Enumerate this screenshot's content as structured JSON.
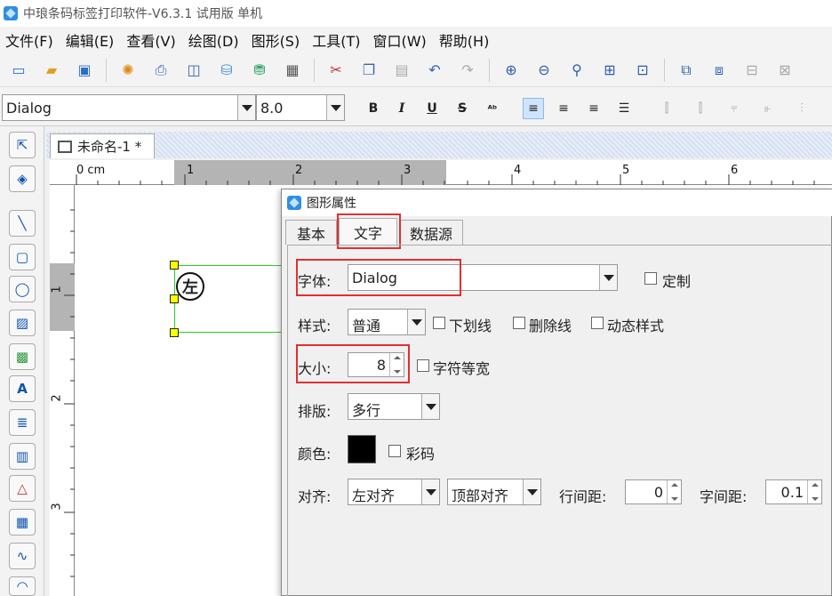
{
  "app": {
    "title": "中琅条码标签打印软件-V6.3.1 试用版 单机"
  },
  "menu": [
    "文件(F)",
    "编辑(E)",
    "查看(V)",
    "绘图(D)",
    "图形(S)",
    "工具(T)",
    "窗口(W)",
    "帮助(H)"
  ],
  "format_toolbar": {
    "font_value": "Dialog",
    "size_value": "8.0",
    "bold": "B",
    "italic": "I",
    "underline": "U",
    "strike": "S"
  },
  "document": {
    "tab_label": "未命名-1 *"
  },
  "ruler": {
    "h_labels": [
      "0 cm",
      "1",
      "2",
      "3",
      "4",
      "5",
      "6"
    ],
    "v_labels": [
      "1",
      "2",
      "3"
    ]
  },
  "canvas": {
    "glyph": "左"
  },
  "dialog": {
    "title": "图形属性",
    "tabs": [
      "基本",
      "文字",
      "数据源"
    ],
    "font": {
      "label": "字体:",
      "value": "Dialog",
      "custom_label": "定制"
    },
    "style": {
      "label": "样式:",
      "value": "普通",
      "underline": "下划线",
      "strikethrough": "删除线",
      "dynamic": "动态样式"
    },
    "size": {
      "label": "大小:",
      "value": "8",
      "monospace": "字符等宽"
    },
    "layout": {
      "label": "排版:",
      "value": "多行"
    },
    "color": {
      "label": "颜色:",
      "color_code": "彩码",
      "swatch": "#000000"
    },
    "align": {
      "label": "对齐:",
      "h_value": "左对齐",
      "v_value": "顶部对齐",
      "line_spacing_label": "行间距:",
      "line_spacing": "0",
      "char_spacing_label": "字间距:",
      "char_spacing": "0.1"
    }
  }
}
